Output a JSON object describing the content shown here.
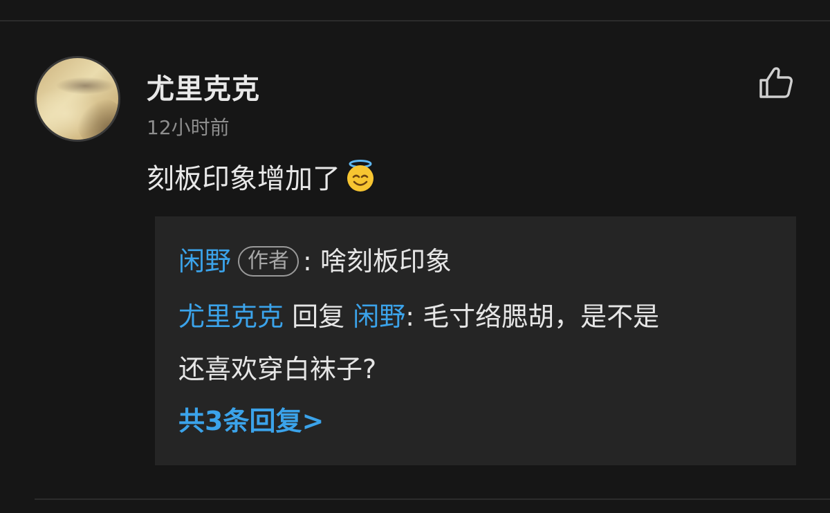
{
  "comment": {
    "username": "尤里克克",
    "timestamp": "12小时前",
    "text": "刻板印象增加了",
    "emoji": "smiling-face-with-halo"
  },
  "replies": {
    "first": {
      "author": "闲野",
      "badge": "作者",
      "separator": ": ",
      "text": "啥刻板印象"
    },
    "second": {
      "author": "尤里克克",
      "reply_word": " 回复 ",
      "target": "闲野",
      "separator": ": ",
      "text_line1": "毛寸络腮胡，是不是",
      "text_line2": "还喜欢穿白袜子?"
    },
    "more_label": "共3条回复>"
  },
  "colors": {
    "background": "#161616",
    "reply_box": "#252525",
    "link_blue": "#3ba3ea",
    "muted": "#8e8e8e"
  }
}
